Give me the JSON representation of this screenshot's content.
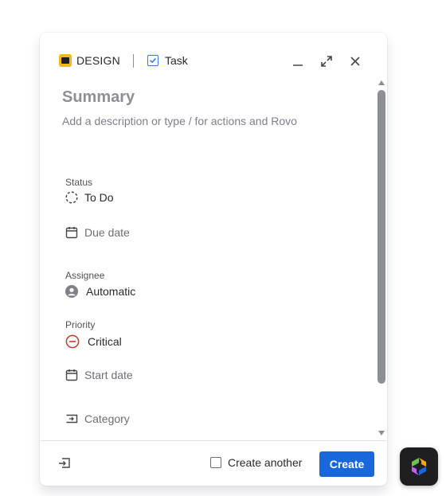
{
  "header": {
    "project_name": "DESIGN",
    "project_icon": "project-avatar-icon",
    "issue_type": "Task",
    "issue_type_icon": "task-checkbox-icon",
    "minimize_icon": "minimize-icon",
    "expand_icon": "expand-icon",
    "close_icon": "close-icon"
  },
  "form": {
    "summary_placeholder": "Summary",
    "description_placeholder": "Add a description or type / for actions and Rovo"
  },
  "fields": {
    "status": {
      "label": "Status",
      "value": "To Do",
      "icon": "status-todo-icon"
    },
    "due_date": {
      "value": "Due date",
      "icon": "calendar-icon"
    },
    "assignee": {
      "label": "Assignee",
      "value": "Automatic",
      "icon": "avatar-icon"
    },
    "priority": {
      "label": "Priority",
      "value": "Critical",
      "icon": "priority-critical-icon",
      "color": "#c9372c"
    },
    "start_date": {
      "value": "Start date",
      "icon": "calendar-icon"
    },
    "category": {
      "value": "Category",
      "icon": "category-icon"
    }
  },
  "footer": {
    "import_icon": "import-icon",
    "create_another_label": "Create another",
    "create_another_checked": false,
    "create_label": "Create"
  },
  "colors": {
    "primary": "#1868db",
    "project_badge": "#f5b81c",
    "task_icon": "#357de8",
    "priority_critical": "#c9372c"
  },
  "rovo": {
    "icon": "rovo-icon"
  }
}
